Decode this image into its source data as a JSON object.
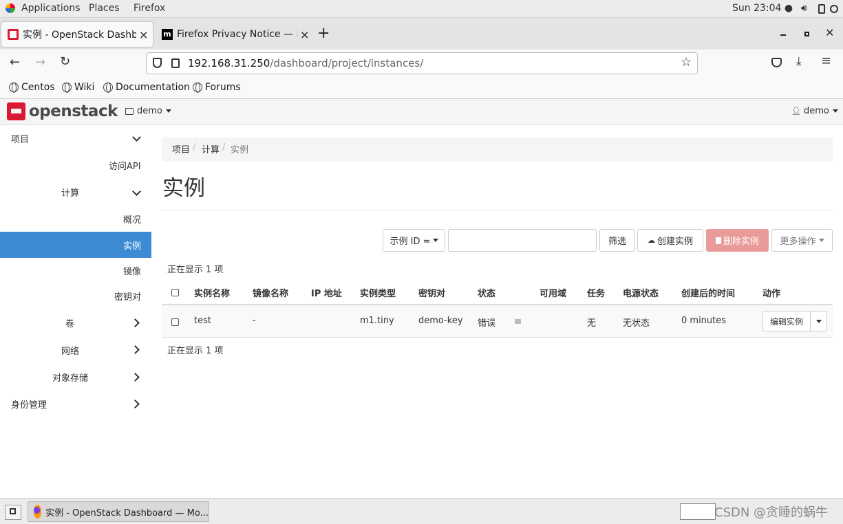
{
  "topbar": {
    "applications": "Applications",
    "places": "Places",
    "firefox": "Firefox",
    "clock": "Sun 23:04 ●"
  },
  "tabs": [
    {
      "title": "实例 - OpenStack Dashbo",
      "close": "×"
    },
    {
      "title": "Firefox Privacy Notice — M",
      "close": "×"
    }
  ],
  "new_tab": "+",
  "url": {
    "host": "192.168.31.250",
    "path": "/dashboard/project/instances/"
  },
  "bookmarks": [
    "Centos",
    "Wiki",
    "Documentation",
    "Forums"
  ],
  "header": {
    "brand": "openstack",
    "project": "demo",
    "user": "demo"
  },
  "sidebar": {
    "project": "项目",
    "api": "访问API",
    "compute": "计算",
    "overview": "概况",
    "instances": "实例",
    "images": "镜像",
    "keypairs": "密钥对",
    "volumes": "卷",
    "network": "网络",
    "object_store": "对象存储",
    "identity": "身份管理"
  },
  "breadcrumb": [
    "项目",
    "计算",
    "实例"
  ],
  "page_title": "实例",
  "toolbar": {
    "filter_field": "示例 ID =",
    "filter_placeholder": "",
    "filter_button": "筛选",
    "create": "创建实例",
    "delete": "删除实例",
    "more": "更多操作"
  },
  "showing": "正在显示 1 项",
  "columns": [
    "实例名称",
    "镜像名称",
    "IP 地址",
    "实例类型",
    "密钥对",
    "状态",
    "可用域",
    "任务",
    "电源状态",
    "创建后的时间",
    "动作"
  ],
  "rows": [
    {
      "name": "test",
      "image": "-",
      "ip": "",
      "flavor": "m1.tiny",
      "keypair": "demo-key",
      "status": "错误",
      "az": "",
      "task": "无",
      "power": "无状态",
      "age": "0 minutes",
      "action": "编辑实例"
    }
  ],
  "footer_showing": "正在显示 1 项",
  "taskbar": {
    "window": "实例 - OpenStack Dashboard — Mo...",
    "watermark": "CSDN @贪睡的蜗牛"
  },
  "colors": {
    "active_nav": "#3d8bd2",
    "danger_disabled": "#e89b98",
    "brand_red": "#da1a32",
    "link": "#337ab7"
  }
}
